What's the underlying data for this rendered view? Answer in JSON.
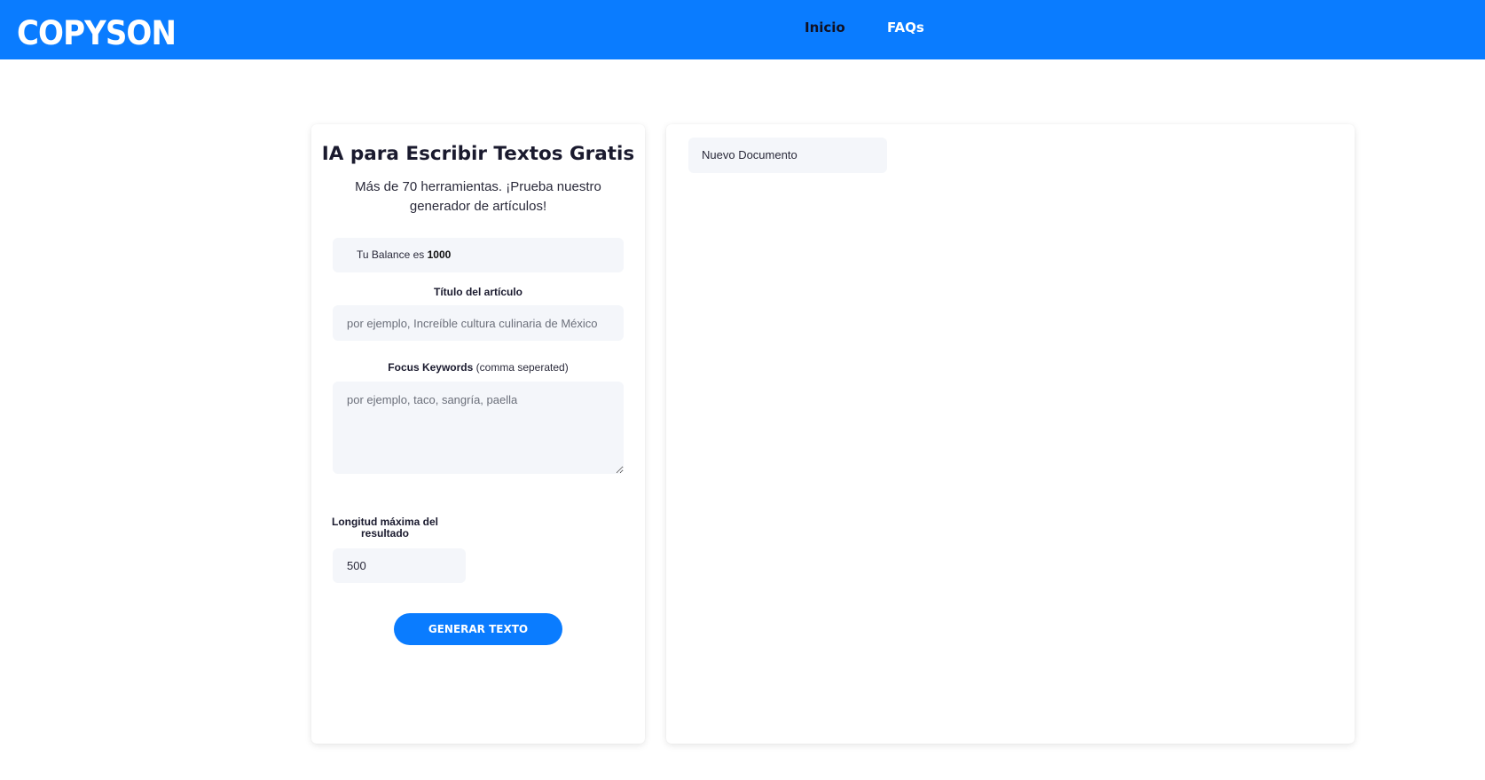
{
  "header": {
    "logo": "COPYSON",
    "nav": [
      {
        "label": "Inicio"
      },
      {
        "label": "FAQs"
      }
    ],
    "background_color": "#0a7cff"
  },
  "form": {
    "title": "IA para Escribir Textos Gratis",
    "subtitle": "Más de 70 herramientas. ¡Prueba nuestro generador de artículos!",
    "balance": {
      "prefix": "Tu Balance es",
      "value": "1000"
    },
    "article_title": {
      "label": "Título del artículo",
      "placeholder": "por ejemplo, Increíble cultura culinaria de México"
    },
    "keywords": {
      "label": "Focus Keywords",
      "hint": "(comma seperated)",
      "placeholder": "por ejemplo, taco, sangría, paella"
    },
    "max_length": {
      "label": "Longitud máxima del resultado",
      "value": "500"
    },
    "submit_label": "GENERAR TEXTO",
    "accent_color": "#0a7cff"
  },
  "documents": {
    "tabs": [
      {
        "label": "Nuevo Documento"
      }
    ]
  }
}
